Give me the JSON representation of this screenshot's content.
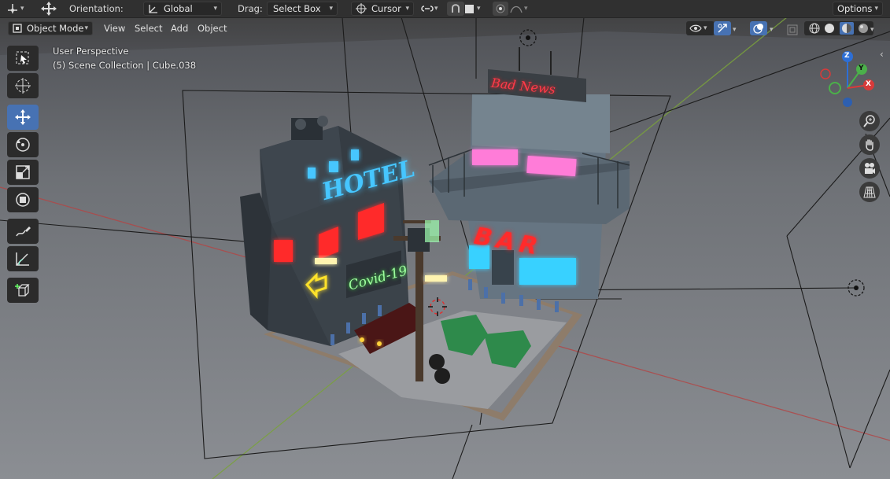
{
  "header": {
    "orientation_label": "Orientation:",
    "orientation_value": "Global",
    "drag_label": "Drag:",
    "drag_value": "Select Box",
    "pivot_value": "Cursor",
    "options_label": "Options"
  },
  "viewport_header": {
    "mode_value": "Object Mode",
    "menus": [
      "View",
      "Select",
      "Add",
      "Object"
    ]
  },
  "overlay": {
    "perspective": "User Perspective",
    "collection": "(5) Scene Collection | Cube.038"
  },
  "gizmo": {
    "z": "Z",
    "y": "Y",
    "x": "X"
  },
  "scene": {
    "hotel_sign": "HOTEL",
    "bar_sign": "BAR",
    "covid_sign": "Covid-19",
    "roof_sign": "Bad News"
  },
  "colors": {
    "active_tool": "#4772b3",
    "neon_blue": "#46c6ff",
    "neon_red": "#ff2b2b",
    "neon_pink": "#ff7bd8",
    "neon_green": "#9fff9f",
    "neon_yellow": "#ffe22a"
  },
  "toolbar_tools": [
    "select-box-icon",
    "cursor-icon",
    "move-icon",
    "rotate-icon",
    "scale-icon",
    "transform-icon",
    "annotate-icon",
    "measure-icon",
    "add-cube-icon"
  ]
}
